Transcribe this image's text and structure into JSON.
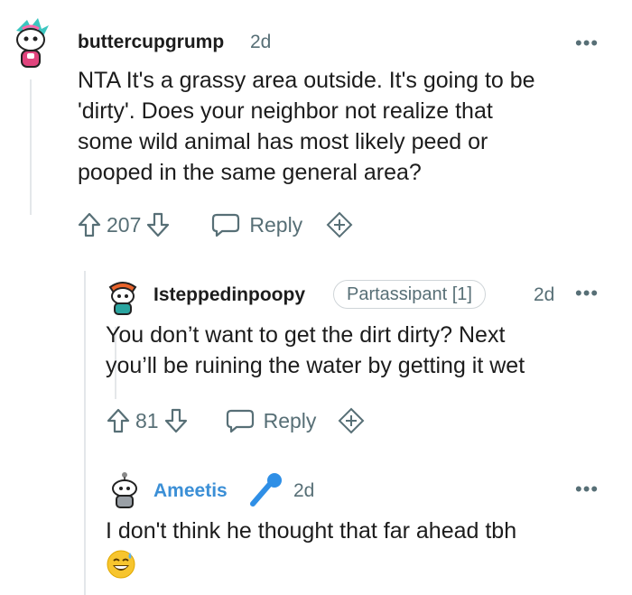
{
  "comments": [
    {
      "username": "buttercupgrump",
      "age": "2d",
      "more": "•••",
      "body": [
        "NTA It's a grassy area outside. It's going to be",
        "'dirty'. Does your neighbor not realize that",
        "some wild animal has most likely peed or",
        "pooped in the same general area?"
      ],
      "votes": "207",
      "reply_label": "Reply"
    },
    {
      "username": "Isteppedinpoopy",
      "flair": "Partassipant [1]",
      "age": "2d",
      "more": "•••",
      "body": [
        "You don’t want to get the dirt dirty? Next",
        "you’ll be ruining the water by getting it wet"
      ],
      "votes": "81",
      "reply_label": "Reply"
    },
    {
      "username": "Ameetis",
      "username_color": "#3b8fd6",
      "age": "2d",
      "more": "•••",
      "body": [
        "I don't think he thought that far ahead tbh"
      ],
      "emoji": "sweat-smile-emoji"
    }
  ],
  "colors": {
    "meta": "#576f76",
    "thread_line": "#e4e7ea",
    "text": "#1c1c1c",
    "ameetis_name": "#3b8fd6",
    "mic_blue": "#2f8fe6"
  }
}
